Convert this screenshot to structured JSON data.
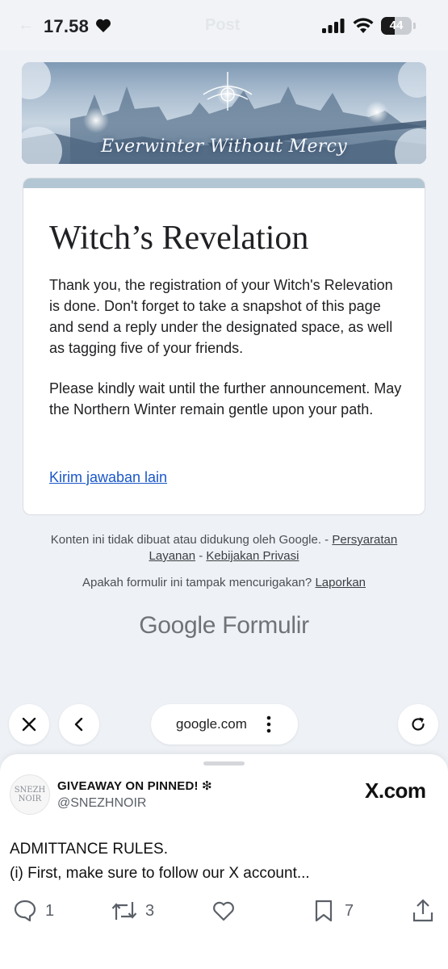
{
  "status_bar": {
    "time": "17.58",
    "battery": "44",
    "battery_fraction": 0.44,
    "ghost_title": "Post",
    "icons": [
      "heart-icon",
      "cellular-signal-icon",
      "wifi-icon",
      "battery-icon"
    ]
  },
  "banner": {
    "caption": "Everwinter Without Mercy"
  },
  "form": {
    "accent_color": "#b3c6d3",
    "title": "Witch’s Revelation",
    "paragraph_1": "Thank you, the registration of your Witch's Relevation is done. Don't forget to take a snapshot of this page and send a reply under the designated space, as well as tagging five of your friends.",
    "paragraph_2": "Please kindly wait until the further announcement. May the Northern Winter remain gentle upon your path.",
    "another_response_link": "Kirim jawaban lain"
  },
  "footer": {
    "disclaimer": "Konten ini tidak dibuat atau didukung oleh Google. -",
    "terms_link": "Persyaratan Layanan",
    "separator": "-",
    "privacy_link": "Kebijakan Privasi",
    "suspicious_text": "Apakah formulir ini tampak mencurigakan?",
    "report_link": "Laporkan",
    "brand_google": "Google",
    "brand_forms": "Formulir"
  },
  "browser": {
    "url": "google.com",
    "icons": [
      "close-icon",
      "back-chevron-icon",
      "more-vertical-icon",
      "reload-icon"
    ]
  },
  "sheet": {
    "avatar_text_line1": "SNEZH",
    "avatar_text_line2": "NOIR",
    "account_name": "GIVEAWAY ON PINNED! ❇",
    "handle": "@SNEZHNOIR",
    "site": "X.com",
    "post_line1": "ADMITTANCE RULES.",
    "post_line2": "(i) First, make sure to follow our X account...",
    "replies": "1",
    "reposts": "3",
    "bookmarks": "7",
    "icons": [
      "reply-icon",
      "repost-icon",
      "like-icon",
      "bookmark-icon",
      "share-icon"
    ]
  }
}
